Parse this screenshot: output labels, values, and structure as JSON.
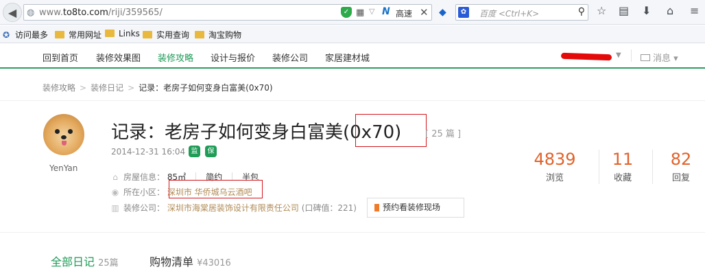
{
  "browser": {
    "url_prefix": "www.",
    "url_domain": "to8to.com",
    "url_path": "/riji/359565/",
    "speed_label": "高速",
    "search_placeholder": "百度 <Ctrl+K>",
    "bookmarks": [
      "访问最多",
      "常用网址",
      "Links",
      "实用查询",
      "淘宝购物"
    ]
  },
  "nav": {
    "items": [
      "回到首页",
      "装修效果图",
      "装修攻略",
      "设计与报价",
      "装修公司",
      "家居建材城"
    ],
    "active_index": 2,
    "message_label": "消息"
  },
  "breadcrumb": {
    "items": [
      "装修攻略",
      "装修日记"
    ],
    "current": "记录：老房子如何变身白富美(0x70)"
  },
  "profile": {
    "username": "YenYan"
  },
  "diary": {
    "title": "记录：老房子如何变身白富美(0x70)",
    "count_tag": "[ 25 篇 ]",
    "date": "2014-12-31 16:04",
    "badges": [
      "监",
      "保"
    ],
    "house_label": "房屋信息：",
    "house_area": "85㎡",
    "house_style": "简约",
    "house_type": "半包",
    "community_label": "所在小区：",
    "community_value": "深圳市 华侨城乌云酒吧",
    "company_label": "装修公司：",
    "company_value": "深圳市海棠居装饰设计有限责任公司",
    "company_score": "(口碑值：221)",
    "appointment_button": "预约看装修现场"
  },
  "stats": [
    {
      "value": "4839",
      "label": "浏览"
    },
    {
      "value": "11",
      "label": "收藏"
    },
    {
      "value": "82",
      "label": "回复"
    }
  ],
  "tabs": {
    "all_label": "全部日记",
    "all_count": "25篇",
    "shop_label": "购物清单",
    "shop_value": "¥43016"
  },
  "colors": {
    "accent_green": "#1e9a58",
    "stat_orange": "#e0622a",
    "highlight_red": "#d2141a"
  }
}
